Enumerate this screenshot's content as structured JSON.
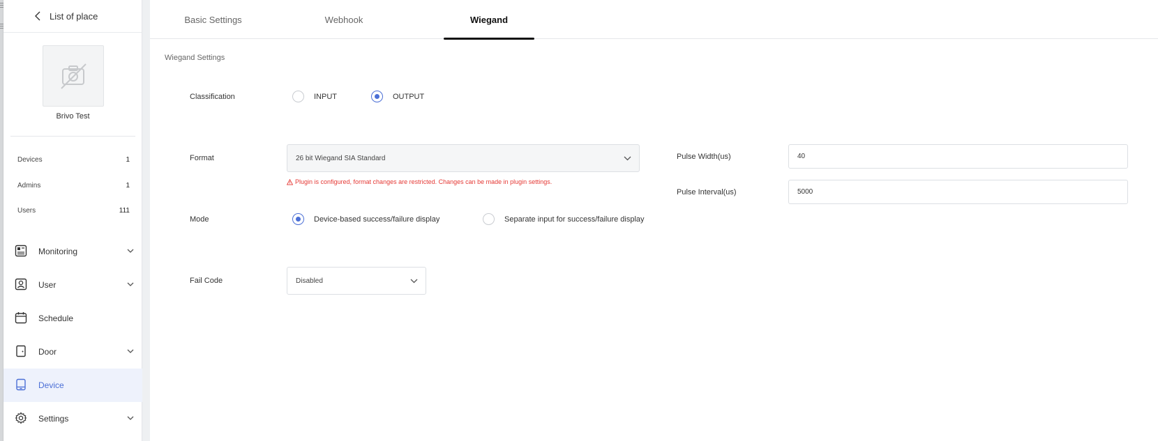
{
  "sidebar": {
    "back_label": "List of place",
    "place_name": "Brivo Test",
    "stats": [
      {
        "label": "Devices",
        "value": "1"
      },
      {
        "label": "Admins",
        "value": "1"
      },
      {
        "label": "Users",
        "value": "111"
      }
    ],
    "nav": [
      {
        "label": "Monitoring",
        "icon": "monitoring-icon",
        "expandable": true
      },
      {
        "label": "User",
        "icon": "user-icon",
        "expandable": true
      },
      {
        "label": "Schedule",
        "icon": "calendar-icon",
        "expandable": false
      },
      {
        "label": "Door",
        "icon": "door-icon",
        "expandable": true
      },
      {
        "label": "Device",
        "icon": "device-icon",
        "expandable": false,
        "active": true
      },
      {
        "label": "Settings",
        "icon": "gear-icon",
        "expandable": true
      }
    ]
  },
  "tabs": [
    {
      "label": "Basic Settings",
      "active": false
    },
    {
      "label": "Webhook",
      "active": false
    },
    {
      "label": "Wiegand",
      "active": true
    }
  ],
  "wiegand": {
    "section_title": "Wiegand Settings",
    "classification": {
      "label": "Classification",
      "options": [
        "INPUT",
        "OUTPUT"
      ],
      "selected": "OUTPUT"
    },
    "format": {
      "label": "Format",
      "value": "26 bit Wiegand SIA Standard",
      "warning": "Plugin is configured, format changes are restricted. Changes can be made in plugin settings."
    },
    "pulse_width": {
      "label": "Pulse Width(us)",
      "value": "40"
    },
    "pulse_interval": {
      "label": "Pulse Interval(us)",
      "value": "5000"
    },
    "mode": {
      "label": "Mode",
      "options": [
        "Device-based success/failure display",
        "Separate input for success/failure display"
      ],
      "selected": "Device-based success/failure display"
    },
    "fail_code": {
      "label": "Fail Code",
      "value": "Disabled"
    }
  },
  "colors": {
    "accent": "#4b6fd6",
    "warning": "#e53935",
    "active_nav_bg": "#eef2fc"
  }
}
